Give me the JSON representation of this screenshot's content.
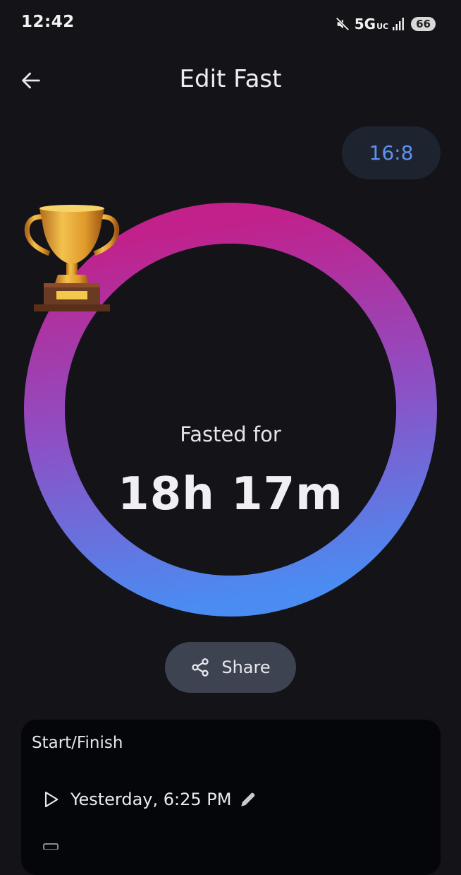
{
  "status_bar": {
    "time": "12:42",
    "network": "5G",
    "network_sub": "UC",
    "battery": "66",
    "icons": [
      "mute-icon",
      "signal-icon"
    ]
  },
  "app_bar": {
    "title": "Edit Fast",
    "back_icon": "arrow-left-icon"
  },
  "plan": {
    "label": "16:8",
    "color": "#5B93F0"
  },
  "ring": {
    "gradient_colors": [
      "#C2208A",
      "#8E4FC4",
      "#4A8CF2"
    ],
    "icon": "trophy-icon"
  },
  "summary": {
    "label": "Fasted for",
    "duration": "18h 17m"
  },
  "share": {
    "label": "Share",
    "icon": "share-icon"
  },
  "card": {
    "title": "Start/Finish",
    "start": {
      "value": "Yesterday, 6:25 PM",
      "icon": "play-icon",
      "edit_icon": "pencil-icon"
    }
  }
}
